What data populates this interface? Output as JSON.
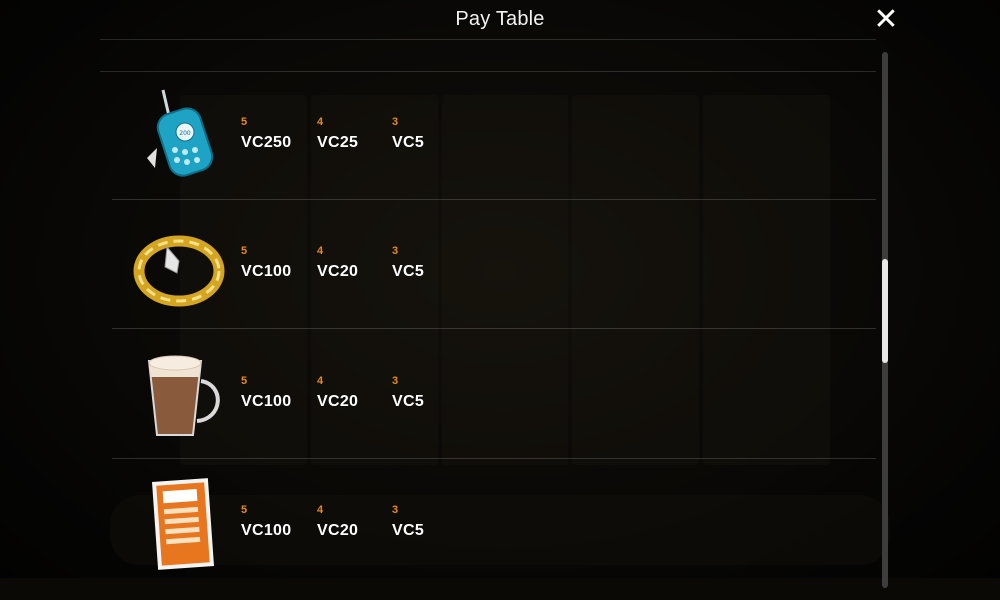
{
  "dialog": {
    "title": "Pay Table",
    "close_icon": "close-icon"
  },
  "rows": [
    {
      "symbol": "phone-icon",
      "pays": [
        {
          "count": "5",
          "amount": "VC250"
        },
        {
          "count": "4",
          "amount": "VC25"
        },
        {
          "count": "3",
          "amount": "VC5"
        }
      ]
    },
    {
      "symbol": "bracelet-icon",
      "pays": [
        {
          "count": "5",
          "amount": "VC100"
        },
        {
          "count": "4",
          "amount": "VC20"
        },
        {
          "count": "3",
          "amount": "VC5"
        }
      ]
    },
    {
      "symbol": "coffee-icon",
      "pays": [
        {
          "count": "5",
          "amount": "VC100"
        },
        {
          "count": "4",
          "amount": "VC20"
        },
        {
          "count": "3",
          "amount": "VC5"
        }
      ]
    },
    {
      "symbol": "penalty-ticket-icon",
      "pays": [
        {
          "count": "5",
          "amount": "VC100"
        },
        {
          "count": "4",
          "amount": "VC20"
        },
        {
          "count": "3",
          "amount": "VC5"
        }
      ]
    }
  ],
  "colors": {
    "count_text": "#e88a1a",
    "amount_text": "#ffffff",
    "title_text": "#f2f2f2"
  },
  "scrollbar": {
    "position_fraction": 0.48
  }
}
